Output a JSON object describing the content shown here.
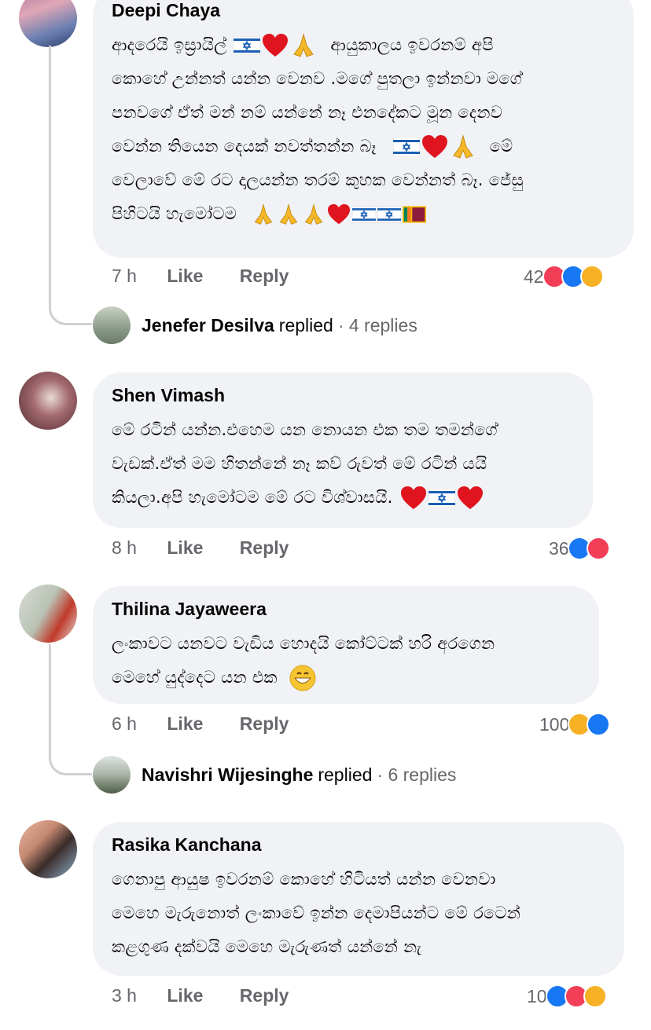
{
  "comments": [
    {
      "author": "Deepi Chaya",
      "lines": [
        "ආදරෙයි ඉස්‍රායිල්",
        "ආයුකාලය ඉවරනම් අපි",
        "කොහේ උන්නත් යන්න වෙනව .මගේ පුතලා ඉන්නවා මගේ",
        "පනවගේ ඒත් මන් නම් යන්නේ නෑ එනදේකට මූන දෙනව",
        "වෙන්න තියෙන දෙයක් නවත්තන්න බෑ",
        "මේ",
        "වෙලාවේ මේ රට දාලයන්න තරම් කුහක වෙන්නත් බෑ. ජේසු",
        "පිහිටයි හැමෝටම"
      ],
      "time": "7 h",
      "like": "Like",
      "reply": "Reply",
      "count": "42",
      "reactions": [
        "love",
        "like",
        "care"
      ]
    },
    {
      "author": "Shen Vimash",
      "lines": [
        "මේ රටින් යන්න.එහෙම යන නොයන එක තම තමන්ගේ",
        "වැඩක්.ඒත් මම හිතන්නේ නෑ කව් රුවත් මේ රටින් යයි",
        "කියලා.අපි හැමෝටම මේ රට විශ්වාසයි."
      ],
      "time": "8 h",
      "like": "Like",
      "reply": "Reply",
      "count": "36",
      "reactions": [
        "like",
        "love"
      ]
    },
    {
      "author": "Thilina Jayaweera",
      "lines": [
        "ලංකාවට යනවට වැඩිය හොදයි කෝට්ටක් හරි අරගෙන",
        "මෙහේ යුද්දෙට යන එක"
      ],
      "time": "6 h",
      "like": "Like",
      "reply": "Reply",
      "count": "100",
      "reactions": [
        "haha",
        "like"
      ]
    },
    {
      "author": "Rasika Kanchana",
      "lines": [
        "ගෙනාපු ආයුෂ ඉවරනම් කොහේ හිටියත් යන්න වෙනවා",
        "මෙහෙ මැරුනොත් ලංකාවේ ඉන්න දෙමාපියන්ට මේ රටෙන්",
        "කළගුණ දක්වයි මෙහෙ මැරුණත් යන්නේ නැ"
      ],
      "time": "3 h",
      "like": "Like",
      "reply": "Reply",
      "count": "10",
      "reactions": [
        "like",
        "love",
        "haha"
      ]
    }
  ],
  "replies": [
    {
      "name": "Jenefer Desilva",
      "text": "replied",
      "count": "· 4 replies"
    },
    {
      "name": "Navishri Wijesinghe",
      "text": "replied",
      "count": "· 6 replies"
    }
  ],
  "colors": {
    "like": "#1877f2",
    "love": "#f33e58",
    "haha": "#f7b125",
    "bubble": "#f0f2f5",
    "meta": "#65676b"
  }
}
